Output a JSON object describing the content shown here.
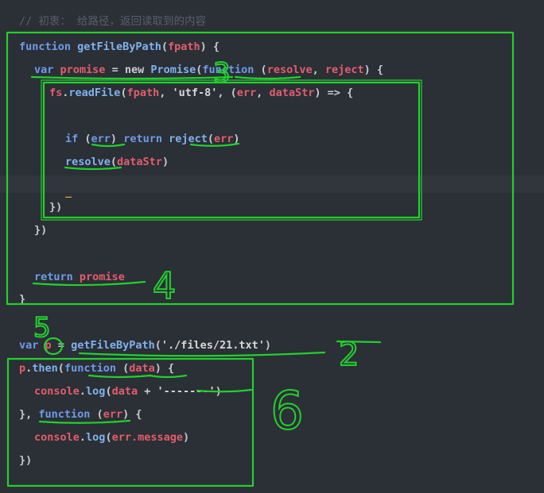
{
  "comment": "// 初衷： 给路径，返回读取到的内容",
  "code": {
    "l1": {
      "kw": "function",
      "name": "getFileByPath",
      "p1": "(",
      "param": "fpath",
      "p2": ") {"
    },
    "l2": {
      "kw": "var",
      "var": "promise",
      "eq": " = new ",
      "cls": "Promise",
      "p1": "(",
      "kw2": "function",
      "p2": " (",
      "a1": "resolve",
      "c": ", ",
      "a2": "reject",
      "p3": ") {"
    },
    "l3": {
      "obj": "fs",
      "dot": ".",
      "m": "readFile",
      "p1": "(",
      "a1": "fpath",
      "c": ", ",
      "s": "'utf-8'",
      "c2": ", (",
      "e": "err",
      "c3": ", ",
      "d": "dataStr",
      "arrow": ") => {"
    },
    "l4": {
      "kw": "if",
      "p1": " (",
      "e": "err",
      "p2": ") ",
      "kw2": "return",
      "sp": " ",
      "fn": "reject",
      "p3": "(",
      "e2": "err",
      "p4": ")"
    },
    "l5": {
      "fn": "resolve",
      "p1": "(",
      "a": "dataStr",
      "p2": ")"
    },
    "l6": {
      "cursor": "_"
    },
    "l7": {
      "t": "})"
    },
    "l8": {
      "t": "})"
    },
    "l9": {
      "kw": "return",
      "v": "promise"
    },
    "l10": {
      "t": "}"
    },
    "l11": {
      "kw": "var",
      "v": "p",
      "eq": " = ",
      "fn": "getFileByPath",
      "p1": "(",
      "s": "'./files/21.txt'",
      "p2": ")"
    },
    "l12": {
      "v": "p",
      "dot": ".",
      "m": "then",
      "p1": "(",
      "kw": "function",
      "p2": " (",
      "a": "data",
      "p3": ") {"
    },
    "l13": {
      "obj": "console",
      "dot": ".",
      "m": "log",
      "p1": "(",
      "a": "data",
      "plus": " + ",
      "s": "'-------'",
      "p2": ")"
    },
    "l14": {
      "p0": "}, ",
      "kw": "function",
      "p1": " (",
      "a": "err",
      "p2": ") {"
    },
    "l15": {
      "obj": "console",
      "dot": ".",
      "m": "log",
      "p1": "(",
      "a": "err.message",
      "p2": ")"
    },
    "l16": {
      "t": "})"
    }
  },
  "annotations": {
    "n2": "2",
    "n3": "3",
    "n4": "4",
    "n5": "5",
    "n6": "6"
  },
  "colors": {
    "box": "#22d02e",
    "underline": "#22d02e",
    "background": "#2b2f36"
  }
}
